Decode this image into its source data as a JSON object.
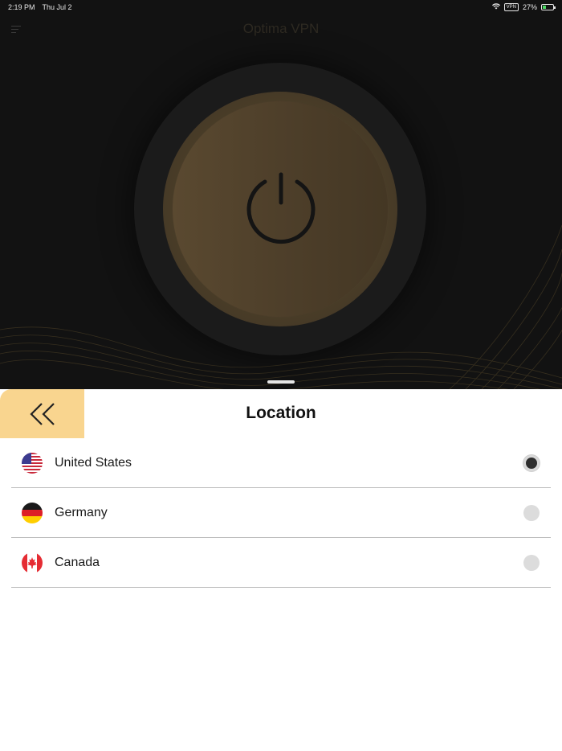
{
  "status_bar": {
    "time": "2:19 PM",
    "date": "Thu Jul 2",
    "vpn_label": "VPN",
    "battery": "27%"
  },
  "header": {
    "title": "Optima VPN",
    "menu_icon": "menu-icon"
  },
  "power_button": {
    "icon": "power-icon",
    "accent_color": "#5a4930"
  },
  "sheet": {
    "title": "Location",
    "back_icon": "double-chevron-left-icon",
    "back_color": "#f9d58f"
  },
  "locations": [
    {
      "name": "United States",
      "flag": "us-flag-icon",
      "selected": true
    },
    {
      "name": "Germany",
      "flag": "germany-flag-icon",
      "selected": false
    },
    {
      "name": "Canada",
      "flag": "canada-flag-icon",
      "selected": false
    }
  ]
}
